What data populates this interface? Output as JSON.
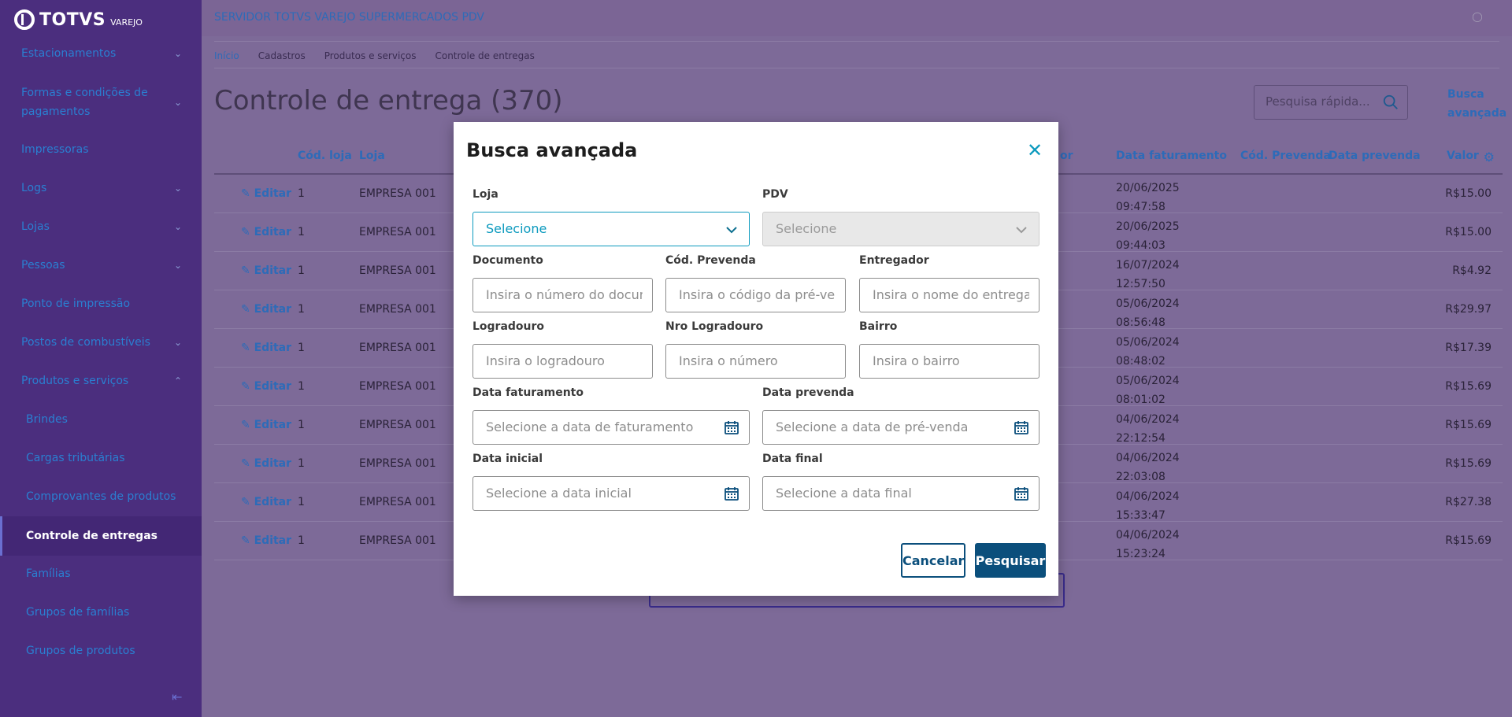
{
  "app": {
    "logo_main": "TOTVS",
    "logo_sub": "VAREJO",
    "server_name": "SERVIDOR TOTVS VAREJO SUPERMERCADOS PDV"
  },
  "sidebar": {
    "items": [
      {
        "label": "Estacionamentos",
        "chevron": "down"
      },
      {
        "label": "Formas e condições de pagamentos",
        "chevron": "down"
      },
      {
        "label": "Impressoras",
        "chevron": ""
      },
      {
        "label": "Logs",
        "chevron": "down"
      },
      {
        "label": "Lojas",
        "chevron": "down"
      },
      {
        "label": "Pessoas",
        "chevron": "down"
      },
      {
        "label": "Ponto de impressão",
        "chevron": ""
      },
      {
        "label": "Postos de combustíveis",
        "chevron": "down"
      },
      {
        "label": "Produtos e serviços",
        "chevron": "up"
      },
      {
        "label": "Brindes",
        "chevron": ""
      },
      {
        "label": "Cargas tributárias",
        "chevron": ""
      },
      {
        "label": "Comprovantes de produtos",
        "chevron": ""
      },
      {
        "label": "Controle de entregas",
        "chevron": ""
      },
      {
        "label": "Famílias",
        "chevron": ""
      },
      {
        "label": "Grupos de famílias",
        "chevron": ""
      },
      {
        "label": "Grupos de produtos",
        "chevron": ""
      }
    ]
  },
  "breadcrumb": [
    "Início",
    "Cadastros",
    "Produtos e serviços",
    "Controle de entregas"
  ],
  "page": {
    "title": "Controle de entrega (370)",
    "search_placeholder": "Pesquisa rápida...",
    "advanced_link": "Busca avançada"
  },
  "table": {
    "headers": {
      "cod_loja": "Cód. loja",
      "loja": "Loja",
      "or": "or",
      "data_faturamento": "Data faturamento",
      "cod_prevenda": "Cód. Prevenda",
      "data_prevenda": "Data prevenda",
      "valor": "Valor"
    },
    "edit_label": "Editar",
    "rows": [
      {
        "cod": "1",
        "loja": "EMPRESA 001",
        "date": "20/06/2025",
        "time": "09:47:58",
        "valor": "R$15.00"
      },
      {
        "cod": "1",
        "loja": "EMPRESA 001",
        "date": "20/06/2025",
        "time": "09:44:03",
        "valor": "R$15.00"
      },
      {
        "cod": "1",
        "loja": "EMPRESA 001",
        "date": "16/07/2024",
        "time": "12:57:50",
        "valor": "R$4.92"
      },
      {
        "cod": "1",
        "loja": "EMPRESA 001",
        "date": "05/06/2024",
        "time": "08:56:48",
        "valor": "R$29.97"
      },
      {
        "cod": "1",
        "loja": "EMPRESA 001",
        "date": "05/06/2024",
        "time": "08:48:02",
        "valor": "R$17.39"
      },
      {
        "cod": "1",
        "loja": "EMPRESA 001",
        "date": "05/06/2024",
        "time": "08:01:02",
        "valor": "R$15.69"
      },
      {
        "cod": "1",
        "loja": "EMPRESA 001",
        "date": "04/06/2024",
        "time": "22:12:54",
        "valor": "R$15.69"
      },
      {
        "cod": "1",
        "loja": "EMPRESA 001",
        "date": "04/06/2024",
        "time": "22:03:08",
        "valor": "R$15.69"
      },
      {
        "cod": "1",
        "loja": "EMPRESA 001",
        "date": "04/06/2024",
        "time": "15:33:47",
        "valor": "R$27.38"
      },
      {
        "cod": "1",
        "loja": "EMPRESA 001",
        "date": "04/06/2024",
        "time": "15:23:24",
        "valor": "R$15.69"
      }
    ]
  },
  "modal": {
    "title": "Busca avançada",
    "loja": {
      "label": "Loja",
      "value": "Selecione"
    },
    "pdv": {
      "label": "PDV",
      "value": "Selecione"
    },
    "documento": {
      "label": "Documento",
      "placeholder": "Insira o número do documento"
    },
    "cod_prevenda": {
      "label": "Cód. Prevenda",
      "placeholder": "Insira o código da pré-venda"
    },
    "entregador": {
      "label": "Entregador",
      "placeholder": "Insira o nome do entregador"
    },
    "logradouro": {
      "label": "Logradouro",
      "placeholder": "Insira o logradouro"
    },
    "nro_logradouro": {
      "label": "Nro Logradouro",
      "placeholder": "Insira o número"
    },
    "bairro": {
      "label": "Bairro",
      "placeholder": "Insira o bairro"
    },
    "data_faturamento": {
      "label": "Data faturamento",
      "placeholder": "Selecione a data de faturamento"
    },
    "data_prevenda": {
      "label": "Data prevenda",
      "placeholder": "Selecione a data de pré-venda"
    },
    "data_inicial": {
      "label": "Data inicial",
      "placeholder": "Selecione a data inicial"
    },
    "data_final": {
      "label": "Data final",
      "placeholder": "Selecione a data final"
    },
    "cancel_label": "Cancelar",
    "search_label": "Pesquisar"
  },
  "colors": {
    "accent": "#0c9abe",
    "primary_button": "#0b4f7c",
    "sidebar": "#4b2e7e",
    "overlay": "#7d6a98"
  }
}
